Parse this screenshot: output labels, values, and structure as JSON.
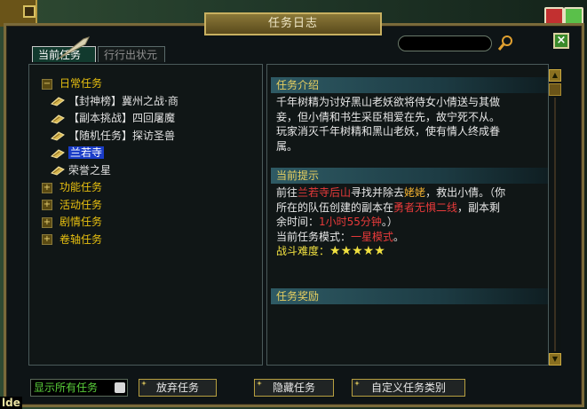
{
  "window": {
    "title": "任务日志"
  },
  "search": {
    "value": ""
  },
  "tabs": [
    {
      "label": "当前任务",
      "active": true
    },
    {
      "label": "行行出状元",
      "active": false
    }
  ],
  "tree": {
    "categories": [
      {
        "label": "日常任务",
        "expander": "−"
      },
      {
        "label": "功能任务",
        "expander": "+"
      },
      {
        "label": "活动任务",
        "expander": "+"
      },
      {
        "label": "剧情任务",
        "expander": "+"
      },
      {
        "label": "卷轴任务",
        "expander": "+"
      }
    ],
    "quests": [
      {
        "label": "【封神榜】冀州之战·商"
      },
      {
        "label": "【副本挑战】四回屠魔"
      },
      {
        "label": "【随机任务】探访圣兽"
      },
      {
        "label": "兰若寺",
        "selected": true
      },
      {
        "label": "荣誉之星"
      }
    ]
  },
  "details": {
    "intro_header": "任务介绍",
    "intro_text": "千年树精为讨好黑山老妖欲将侍女小倩送与其做妾，但小倩和书生采臣相爱在先，故宁死不从。玩家消灭千年树精和黑山老妖，使有情人终成眷属。",
    "hint_header": "当前提示",
    "hint_prefix": "前往",
    "hint_location": "兰若寺后山",
    "hint_mid": "寻找并除去",
    "hint_target": "姥姥",
    "hint_after": "，救出小倩。（你所在的队伍创建的副本在",
    "hint_copy": "勇者无惧二线",
    "hint_time_prefix": "，副本剩余时间：",
    "hint_time": "1小时55分钟",
    "hint_close": "。）",
    "mode_label": "当前任务模式：",
    "mode_value": "一星模式",
    "mode_end": "。",
    "difficulty_label": "战斗难度：",
    "difficulty_stars": "★★★★★",
    "reward_header": "任务奖励"
  },
  "footer": {
    "filter_value": "显示所有任务",
    "abandon_label": "放弃任务",
    "hide_label": "隐藏任务",
    "custom_label": "自定义任务类别"
  },
  "corner_text": "lde",
  "colors": {
    "gold": "#e8c010",
    "accent_red": "#e83a3a",
    "star": "#f0e040"
  }
}
